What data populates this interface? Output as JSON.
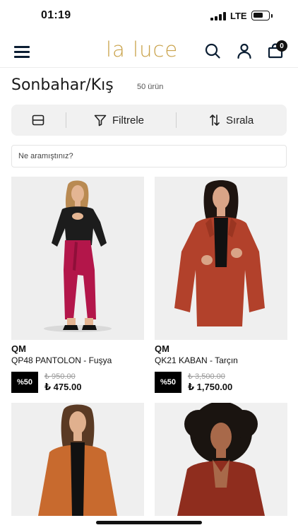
{
  "status": {
    "time": "01:19",
    "network": "LTE"
  },
  "header": {
    "logo": "la luce",
    "cart_count": "0"
  },
  "page": {
    "title": "Sonbahar/Kış",
    "count": "50 ürün"
  },
  "toolbar": {
    "filter_label": "Filtrele",
    "sort_label": "Sırala"
  },
  "search": {
    "placeholder": "Ne aramıştınız?"
  },
  "products": [
    {
      "brand": "QM",
      "name": "QP48 PANTOLON - Fuşya",
      "discount": "%50",
      "old_price": "₺ 950.00",
      "price": "₺ 475.00"
    },
    {
      "brand": "QM",
      "name": "QK21 KABAN - Tarçın",
      "discount": "%50",
      "old_price": "₺ 3,500.00",
      "price": "₺ 1,750.00"
    }
  ],
  "colors": {
    "brand_gold": "#c9a24a",
    "navy_icon": "#0b1e33"
  }
}
